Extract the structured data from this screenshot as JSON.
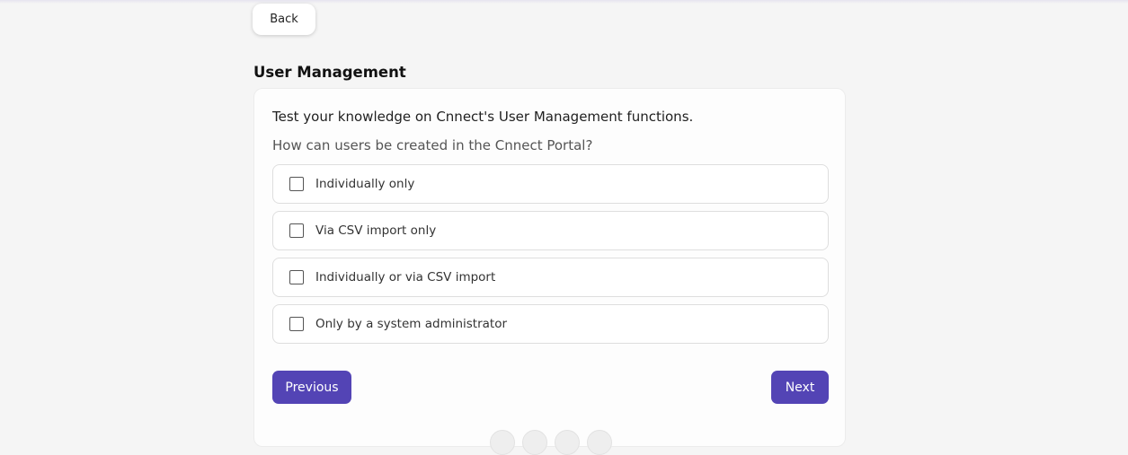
{
  "header": {
    "back_label": "Back"
  },
  "page": {
    "title": "User Management"
  },
  "quiz": {
    "intro": "Test your knowledge on Cnnect's User Management functions.",
    "question": "How can users be created in the Cnnect Portal?",
    "options": [
      {
        "label": "Individually only",
        "checked": false
      },
      {
        "label": "Via CSV import only",
        "checked": false
      },
      {
        "label": "Individually or via CSV import",
        "checked": false
      },
      {
        "label": "Only by a system administrator",
        "checked": false
      }
    ],
    "previous_label": "Previous",
    "next_label": "Next",
    "progress_dots": 4
  },
  "colors": {
    "accent": "#5344b5",
    "background": "#f5f5f5",
    "card": "#fdfdfd"
  }
}
